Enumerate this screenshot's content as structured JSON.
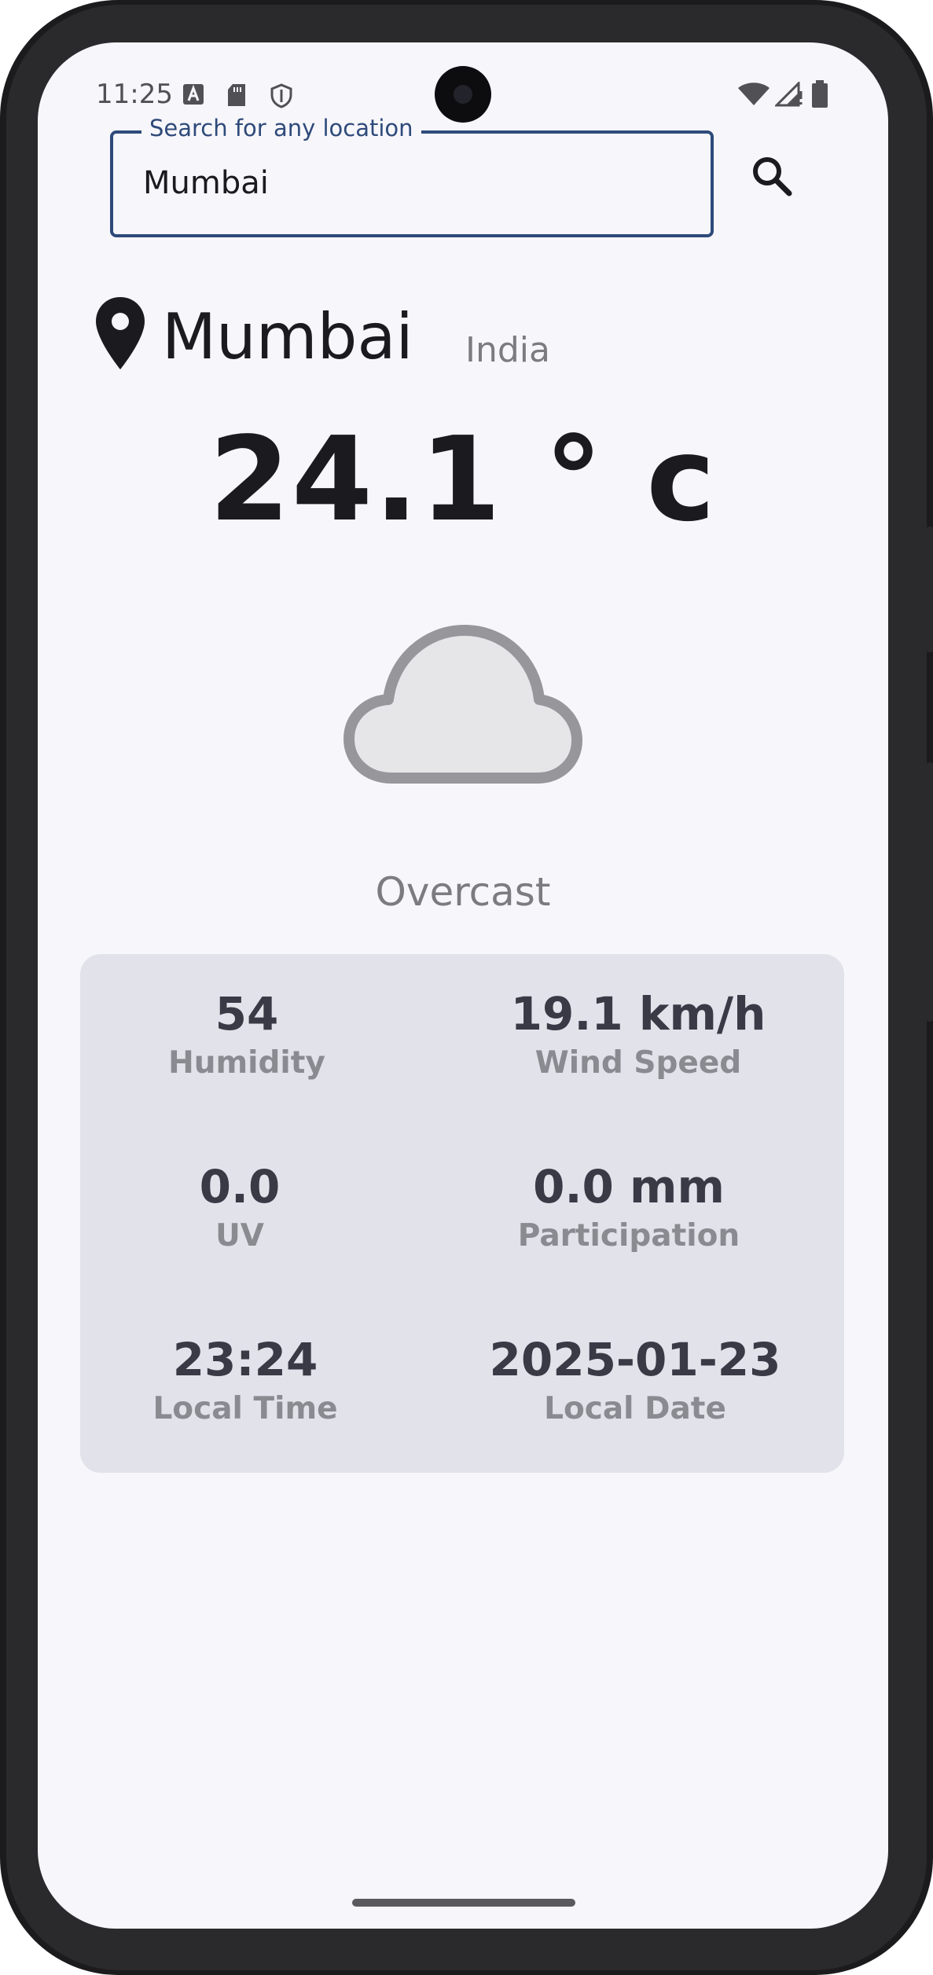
{
  "status_bar": {
    "time": "11:25",
    "icons": [
      "font-a-icon",
      "sd-card-icon",
      "shield-icon",
      "wifi-icon",
      "cell-signal-icon",
      "battery-icon"
    ]
  },
  "search": {
    "label": "Search for any location",
    "value": "Mumbai",
    "button_icon": "search-icon"
  },
  "location": {
    "icon": "map-pin-icon",
    "city": "Mumbai",
    "country": "India"
  },
  "weather": {
    "temperature": "24.1 ° c",
    "icon": "cloud-icon",
    "condition": "Overcast"
  },
  "details": [
    {
      "value": "54",
      "label": "Humidity"
    },
    {
      "value": "19.1 km/h",
      "label": "Wind Speed"
    },
    {
      "value": "0.0",
      "label": "UV"
    },
    {
      "value": "0.0 mm",
      "label": "Participation"
    },
    {
      "value": "23:24",
      "label": "Local Time"
    },
    {
      "value": "2025-01-23",
      "label": "Local Date"
    }
  ],
  "colors": {
    "accent": "#2e4a7a",
    "background": "#f7f6fb",
    "card": "#e2e2ea"
  }
}
